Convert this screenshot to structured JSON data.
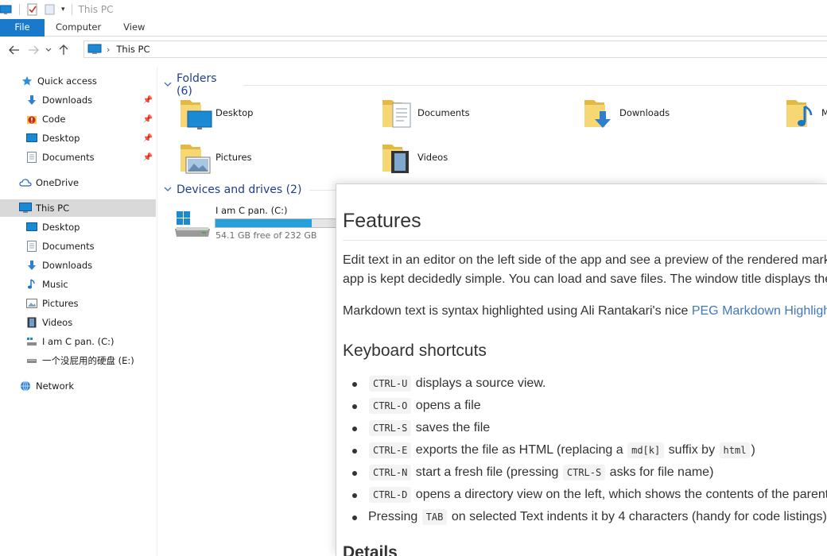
{
  "window": {
    "title": "This PC"
  },
  "ribbon": {
    "tabs": [
      "File",
      "Computer",
      "View"
    ]
  },
  "address": {
    "breadcrumb": [
      "This PC"
    ]
  },
  "sidebar": {
    "quick_access": {
      "label": "Quick access",
      "items": [
        {
          "label": "Downloads",
          "icon": "download-arrow-icon"
        },
        {
          "label": "Code",
          "icon": "code-folder-icon"
        },
        {
          "label": "Desktop",
          "icon": "desktop-icon"
        },
        {
          "label": "Documents",
          "icon": "documents-icon"
        }
      ]
    },
    "onedrive": "OneDrive",
    "this_pc": {
      "label": "This PC",
      "items": [
        {
          "label": "Desktop"
        },
        {
          "label": "Documents"
        },
        {
          "label": "Downloads"
        },
        {
          "label": "Music"
        },
        {
          "label": "Pictures"
        },
        {
          "label": "Videos"
        },
        {
          "label": "I am C pan. (C:)"
        },
        {
          "label": "一个没屁用的硬盘 (E:)"
        }
      ]
    },
    "network": "Network"
  },
  "content": {
    "folders_header": "Folders (6)",
    "folders": [
      {
        "label": "Desktop"
      },
      {
        "label": "Documents"
      },
      {
        "label": "Downloads"
      },
      {
        "label": "M"
      },
      {
        "label": "Pictures"
      },
      {
        "label": "Videos"
      }
    ],
    "devices_header": "Devices and drives (2)",
    "drive": {
      "name": "I am C pan. (C:)",
      "free": "54.1 GB free of 232 GB",
      "used_fraction": 0.767
    }
  },
  "preview": {
    "h1": "Features",
    "p1_line1": "Edit text in an editor on the left side of the app and see a preview of the rendered markdo",
    "p1_line2": "app is kept decidedly simple. You can load and save files. The window title displays the cu",
    "p2_text": "Markdown text is syntax highlighted using Ali Rantakari's nice ",
    "p2_link": "PEG Markdown Highlighte",
    "h2_shortcuts": "Keyboard shortcuts",
    "shortcuts": [
      {
        "parts": [
          {
            "code": "CTRL-U"
          },
          {
            "text": " displays a source view."
          }
        ]
      },
      {
        "parts": [
          {
            "code": "CTRL-O"
          },
          {
            "text": " opens a file"
          }
        ]
      },
      {
        "parts": [
          {
            "code": "CTRL-S"
          },
          {
            "text": " saves the file"
          }
        ]
      },
      {
        "parts": [
          {
            "code": "CTRL-E"
          },
          {
            "text": " exports the file as HTML (replacing a "
          },
          {
            "code": "md[k]"
          },
          {
            "text": " suffix by "
          },
          {
            "code": "html"
          },
          {
            "text": ")"
          }
        ]
      },
      {
        "parts": [
          {
            "code": "CTRL-N"
          },
          {
            "text": " start a fresh file (pressing "
          },
          {
            "code": "CTRL-S"
          },
          {
            "text": " asks for file name)"
          }
        ]
      },
      {
        "parts": [
          {
            "code": "CTRL-D"
          },
          {
            "text": " opens a directory view on the left, which shows the contents of the parent f"
          }
        ]
      },
      {
        "parts": [
          {
            "text": "Pressing "
          },
          {
            "code": "TAB"
          },
          {
            "text": " on selected Text indents it by 4 characters (handy for code listings)."
          }
        ]
      }
    ],
    "h2_details": "Details"
  }
}
